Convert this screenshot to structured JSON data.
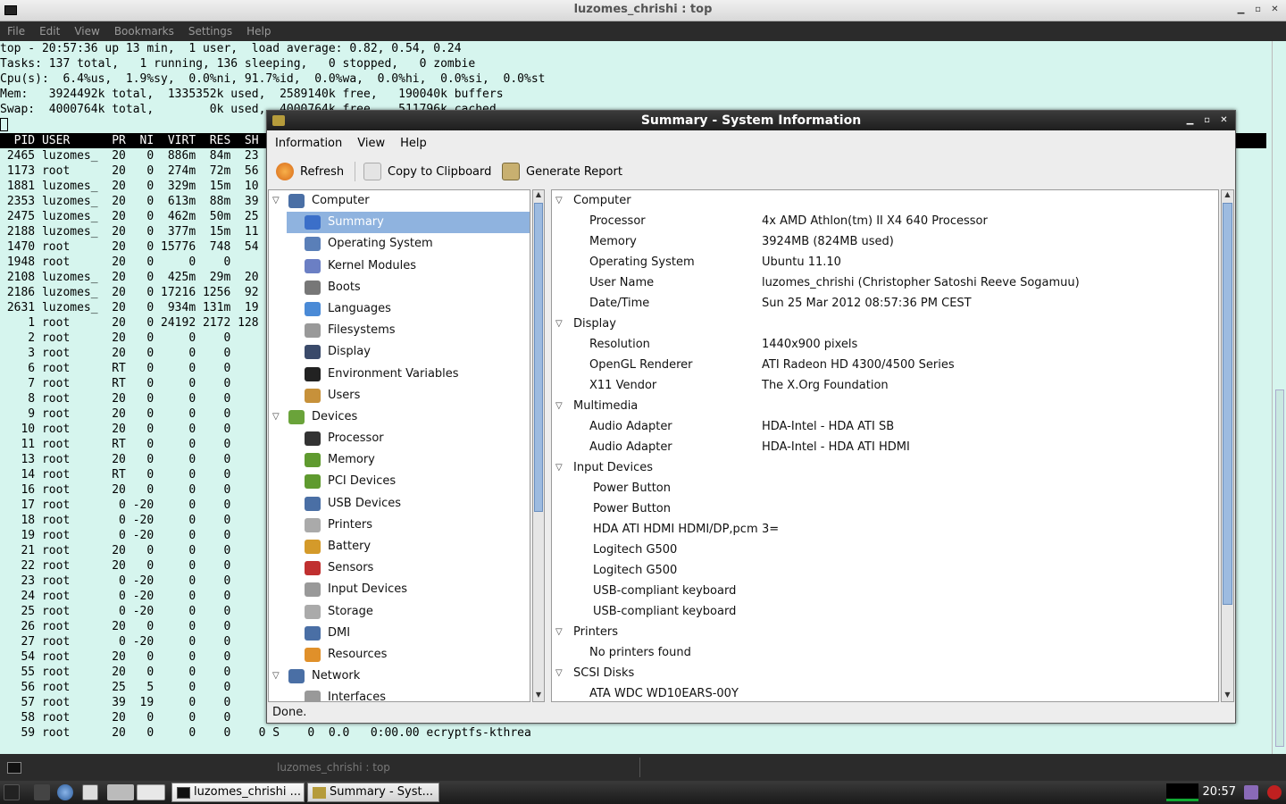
{
  "terminal": {
    "window_title": "luzomes_chrishi : top",
    "menu": [
      "File",
      "Edit",
      "View",
      "Bookmarks",
      "Settings",
      "Help"
    ],
    "summary_lines": [
      "top - 20:57:36 up 13 min,  1 user,  load average: 0.82, 0.54, 0.24",
      "Tasks: 137 total,   1 running, 136 sleeping,   0 stopped,   0 zombie",
      "Cpu(s):  6.4%us,  1.9%sy,  0.0%ni, 91.7%id,  0.0%wa,  0.0%hi,  0.0%si,  0.0%st",
      "Mem:   3924492k total,  1335352k used,  2589140k free,   190040k buffers",
      "Swap:  4000764k total,        0k used,  4000764k free,   511796k cached"
    ],
    "header": "  PID USER      PR  NI  VIRT  RES  SH",
    "process_lines": [
      " 2465 luzomes_  20   0  886m  84m  23",
      " 1173 root      20   0  274m  72m  56",
      " 1881 luzomes_  20   0  329m  15m  10",
      " 2353 luzomes_  20   0  613m  88m  39",
      " 2475 luzomes_  20   0  462m  50m  25",
      " 2188 luzomes_  20   0  377m  15m  11",
      " 1470 root      20   0 15776  748  54",
      " 1948 root      20   0     0    0",
      " 2108 luzomes_  20   0  425m  29m  20",
      " 2186 luzomes_  20   0 17216 1256  92",
      " 2631 luzomes_  20   0  934m 131m  19",
      "    1 root      20   0 24192 2172 128",
      "    2 root      20   0     0    0",
      "    3 root      20   0     0    0",
      "    6 root      RT   0     0    0",
      "    7 root      RT   0     0    0",
      "    8 root      20   0     0    0",
      "    9 root      20   0     0    0",
      "   10 root      20   0     0    0",
      "   11 root      RT   0     0    0",
      "   13 root      20   0     0    0",
      "   14 root      RT   0     0    0",
      "   16 root      20   0     0    0",
      "   17 root       0 -20     0    0",
      "   18 root       0 -20     0    0",
      "   19 root       0 -20     0    0",
      "   21 root      20   0     0    0",
      "   22 root      20   0     0    0",
      "   23 root       0 -20     0    0",
      "   24 root       0 -20     0    0",
      "   25 root       0 -20     0    0",
      "   26 root      20   0     0    0",
      "   27 root       0 -20     0    0",
      "   54 root      20   0     0    0",
      "   55 root      20   0     0    0",
      "   56 root      25   5     0    0",
      "   57 root      39  19     0    0",
      "   58 root      20   0     0    0",
      "   59 root      20   0     0    0    0 S    0  0.0   0:00.00 ecryptfs-kthrea"
    ],
    "status_label": "luzomes_chrishi : top"
  },
  "hardinfo": {
    "window_title": "Summary - System Information",
    "menu": [
      "Information",
      "View",
      "Help"
    ],
    "toolbar": {
      "refresh": "Refresh",
      "copy": "Copy to Clipboard",
      "report": "Generate Report"
    },
    "tree": [
      {
        "kind": "cat",
        "label": "Computer",
        "icon": "computer-icon",
        "color": "#4a6fa5"
      },
      {
        "kind": "item",
        "label": "Summary",
        "icon": "info-icon",
        "color": "#3b6fc9",
        "selected": true
      },
      {
        "kind": "item",
        "label": "Operating System",
        "icon": "gear-icon",
        "color": "#5a7fb8"
      },
      {
        "kind": "item",
        "label": "Kernel Modules",
        "icon": "module-icon",
        "color": "#6b7fc4"
      },
      {
        "kind": "item",
        "label": "Boots",
        "icon": "power-icon",
        "color": "#777777"
      },
      {
        "kind": "item",
        "label": "Languages",
        "icon": "flag-icon",
        "color": "#4a8ad6"
      },
      {
        "kind": "item",
        "label": "Filesystems",
        "icon": "drive-icon",
        "color": "#999999"
      },
      {
        "kind": "item",
        "label": "Display",
        "icon": "monitor-icon",
        "color": "#3a4a6a"
      },
      {
        "kind": "item",
        "label": "Environment Variables",
        "icon": "terminal-icon",
        "color": "#222222"
      },
      {
        "kind": "item",
        "label": "Users",
        "icon": "users-icon",
        "color": "#c7913a"
      },
      {
        "kind": "cat",
        "label": "Devices",
        "icon": "board-icon",
        "color": "#6aa33a"
      },
      {
        "kind": "item",
        "label": "Processor",
        "icon": "cpu-icon",
        "color": "#333333"
      },
      {
        "kind": "item",
        "label": "Memory",
        "icon": "memory-icon",
        "color": "#5f9a2f"
      },
      {
        "kind": "item",
        "label": "PCI Devices",
        "icon": "pci-icon",
        "color": "#5f9a2f"
      },
      {
        "kind": "item",
        "label": "USB Devices",
        "icon": "usb-icon",
        "color": "#4a6fa5"
      },
      {
        "kind": "item",
        "label": "Printers",
        "icon": "printer-icon",
        "color": "#aaaaaa"
      },
      {
        "kind": "item",
        "label": "Battery",
        "icon": "battery-icon",
        "color": "#d49a2a"
      },
      {
        "kind": "item",
        "label": "Sensors",
        "icon": "thermometer-icon",
        "color": "#c03030"
      },
      {
        "kind": "item",
        "label": "Input Devices",
        "icon": "mouse-icon",
        "color": "#999999"
      },
      {
        "kind": "item",
        "label": "Storage",
        "icon": "storage-icon",
        "color": "#aaaaaa"
      },
      {
        "kind": "item",
        "label": "DMI",
        "icon": "dmi-icon",
        "color": "#4a6fa5"
      },
      {
        "kind": "item",
        "label": "Resources",
        "icon": "resources-icon",
        "color": "#e0902a"
      },
      {
        "kind": "cat",
        "label": "Network",
        "icon": "network-icon",
        "color": "#4a6fa5"
      },
      {
        "kind": "item",
        "label": "Interfaces",
        "icon": "interfaces-icon",
        "color": "#999999"
      }
    ],
    "details": [
      {
        "kind": "sec",
        "label": "Computer"
      },
      {
        "kind": "kv",
        "key": "Processor",
        "val": "4x AMD Athlon(tm) II X4 640 Processor"
      },
      {
        "kind": "kv",
        "key": "Memory",
        "val": "3924MB (824MB used)"
      },
      {
        "kind": "kv",
        "key": "Operating System",
        "val": "Ubuntu 11.10"
      },
      {
        "kind": "kv",
        "key": "User Name",
        "val": "luzomes_chrishi (Christopher Satoshi Reeve Sogamuu)"
      },
      {
        "kind": "kv",
        "key": "Date/Time",
        "val": "Sun 25 Mar 2012 08:57:36 PM CEST"
      },
      {
        "kind": "sec",
        "label": "Display"
      },
      {
        "kind": "kv",
        "key": "Resolution",
        "val": "1440x900 pixels"
      },
      {
        "kind": "kv",
        "key": "OpenGL Renderer",
        "val": "ATI Radeon HD 4300/4500 Series"
      },
      {
        "kind": "kv",
        "key": "X11 Vendor",
        "val": "The X.Org Foundation"
      },
      {
        "kind": "sec",
        "label": "Multimedia"
      },
      {
        "kind": "kv",
        "key": "Audio Adapter",
        "val": "HDA-Intel - HDA ATI SB"
      },
      {
        "kind": "kv",
        "key": "Audio Adapter",
        "val": "HDA-Intel - HDA ATI HDMI"
      },
      {
        "kind": "sec",
        "label": "Input Devices"
      },
      {
        "kind": "dev",
        "key": "Power Button",
        "val": ""
      },
      {
        "kind": "dev",
        "key": "Power Button",
        "val": ""
      },
      {
        "kind": "dev",
        "key": "HDA ATI HDMI HDMI/DP,pcm",
        "val": "3="
      },
      {
        "kind": "dev",
        "key": "Logitech G500",
        "val": ""
      },
      {
        "kind": "dev",
        "key": "Logitech G500",
        "val": ""
      },
      {
        "kind": "dev",
        "key": "USB-compliant keyboard",
        "val": ""
      },
      {
        "kind": "dev",
        "key": "USB-compliant keyboard",
        "val": ""
      },
      {
        "kind": "sec",
        "label": "Printers"
      },
      {
        "kind": "kv",
        "key": "No printers found",
        "val": ""
      },
      {
        "kind": "sec",
        "label": "SCSI Disks"
      },
      {
        "kind": "kv",
        "key": "ATA WDC WD10EARS-00Y",
        "val": ""
      }
    ],
    "status": "Done."
  },
  "taskbar": {
    "tasks": [
      "luzomes_chrishi ...",
      "Summary - Syst..."
    ],
    "clock": "20:57"
  }
}
